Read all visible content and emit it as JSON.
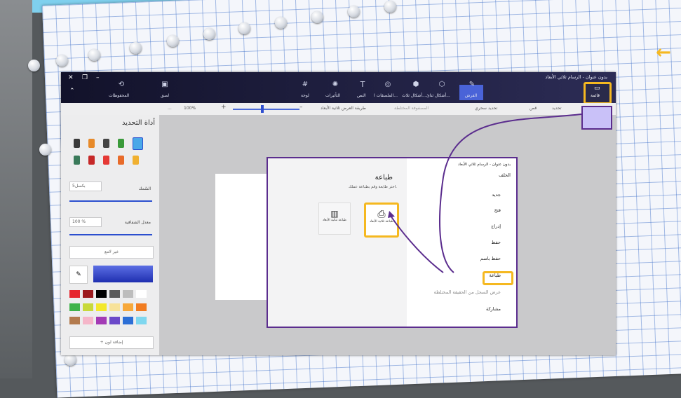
{
  "window": {
    "title": "بدون عنوان - الرسام ثلاثي الأبعاد"
  },
  "ribbon": {
    "menu_label": "قائمة",
    "items": [
      {
        "label": "الفرش",
        "icon": "brush-icon"
      },
      {
        "label": "أشكال ثنائ...",
        "icon": "2d-shapes-icon"
      },
      {
        "label": "أشكال ثلاث...",
        "icon": "3d-shapes-icon"
      },
      {
        "label": "الملصقات ا...",
        "icon": "stickers-icon"
      },
      {
        "label": "النص",
        "icon": "text-icon"
      },
      {
        "label": "التأثيرات",
        "icon": "effects-icon"
      },
      {
        "label": "لوحة",
        "icon": "canvas-icon"
      }
    ],
    "left_items": [
      {
        "label": "لصق",
        "icon": "paste-icon"
      },
      {
        "label": "المحفوظات",
        "icon": "history-icon"
      }
    ]
  },
  "toolbar": {
    "select": "تحديد",
    "magic_select": "تحديد سحري",
    "crop": "قص",
    "mixed_reality": "المصفوفة المختلطة",
    "view_3d": "طريقة العرض ثلاثية الأبعاد",
    "zoom": "100%",
    "more": "..."
  },
  "panel": {
    "title": "أداة التحديد",
    "thickness_label": "السُمك",
    "thickness_value": "5بكسل",
    "opacity_label": "معدل الشفافية",
    "opacity_value": "100 %",
    "finish_label": "غير لامع",
    "add_color_label": "إضافة لون",
    "swatches": [
      "#e6262e",
      "#9c1b1f",
      "#000000",
      "#5a5a5a",
      "#bdbdbd",
      "#ffffff",
      "#3fb34a",
      "#c8d93b",
      "#f3e82c",
      "#f7e29a",
      "#f7a83b",
      "#f17c20",
      "#b37b4e",
      "#f5b6c9",
      "#a33bb5",
      "#6b49c9",
      "#2d6fd6",
      "#7fd7ef"
    ]
  },
  "print_menu": {
    "title_bar": "بدون عنوان - الرسام ثلاثي الأبعاد",
    "back": "الخلف",
    "items": [
      {
        "label": "جديد",
        "icon": "new-file-icon"
      },
      {
        "label": "فتح",
        "icon": "open-folder-icon"
      },
      {
        "label": "إدراج",
        "icon": "insert-icon"
      },
      {
        "label": "حفظ",
        "icon": "save-icon"
      },
      {
        "label": "حفظ باسم",
        "icon": "save-as-icon"
      },
      {
        "label": "طباعة",
        "icon": "print-icon"
      },
      {
        "label": "عرض السجل من الحقيقة المختلطة",
        "icon": "mixed-reality-icon"
      },
      {
        "label": "مشاركة",
        "icon": "share-icon"
      }
    ],
    "print_title": "طباعة",
    "print_subtitle": "اختر طابعة وقم بطباعة عملك.",
    "card_3d": "طباعة ثلاثية الأبعاد",
    "card_2d": "طباعة ثنائية الأبعاد"
  },
  "colors": {
    "accent": "#f5b820",
    "callout": "#5b2d8e",
    "callout_fill": "#c9c1f8",
    "ribbon": "#1b1b38",
    "selected_color": "#4a63d8"
  }
}
